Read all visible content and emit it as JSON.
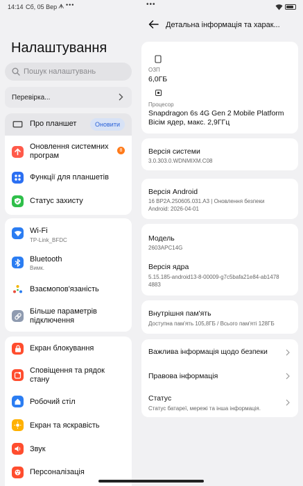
{
  "status": {
    "time": "14:14",
    "date": "Сб, 05 Вер",
    "nfc": "ᗗ",
    "more_left": "•••",
    "more_mid": "•••"
  },
  "left": {
    "title": "Налаштування",
    "search_placeholder": "Пошук налаштувань",
    "check_label": "Перевірка...",
    "about": {
      "label": "Про планшет",
      "button": "Оновити"
    },
    "group1": [
      {
        "label": "Оновлення системних програм",
        "badge": "8"
      },
      {
        "label": "Функції для планшетів"
      },
      {
        "label": "Статус захисту"
      }
    ],
    "group2": [
      {
        "label": "Wi-Fi",
        "sub": "TP-Link_BFDC"
      },
      {
        "label": "Bluetooth",
        "sub": "Вимк."
      },
      {
        "label": "Взаємопов'язаність"
      },
      {
        "label": "Більше параметрів підключення"
      }
    ],
    "group3": [
      {
        "label": "Екран блокування"
      },
      {
        "label": "Сповіщення та рядок стану"
      },
      {
        "label": "Робочий стіл"
      },
      {
        "label": "Екран та яскравість"
      },
      {
        "label": "Звук"
      },
      {
        "label": "Персоналізація"
      }
    ]
  },
  "right": {
    "title": "Детальна інформація та харак...",
    "ram_label": "ОЗП",
    "ram_value": "6,0ГБ",
    "cpu_label": "Процесор",
    "cpu_value_1": "Snapdragon 6s 4G Gen 2 Mobile Platform",
    "cpu_value_2": "Вісім ядер, макс. 2,9ГГц",
    "os_title": "Версія системи",
    "os_value": "3.0.303.0.WDNMIXM.C08",
    "android_title": "Версія Android",
    "android_value_1": "16 BP2A.250605.031.A3 | Оновлення безпеки",
    "android_value_2": "Android: 2026-04-01",
    "model_title": "Модель",
    "model_value": "2603APC14G",
    "kernel_title": "Версія ядра",
    "kernel_value_1": "5.15.185-android13-8-00009-g7c5bafa21e84-ab1478",
    "kernel_value_2": "4883",
    "storage_title": "Внутрішня пам'ять",
    "storage_value": "Доступна пам'ять  105,8ГБ / Всього пам'яті  128ГБ",
    "security_info": "Важлива інформація щодо безпеки",
    "legal_info": "Правова інформація",
    "status_title": "Статус",
    "status_sub": "Статус батареї, мережі та інша інформація."
  },
  "colors": {
    "accent": "#2a62d8",
    "badge": "#ff7a1a",
    "update_icon": "#ff5a4a",
    "features_icon": "#2b6ff2",
    "protect_icon": "#2fbf4a",
    "wifi_icon": "#2b7df2",
    "lock_icon": "#ff4d2e",
    "brightness_icon": "#ffb100"
  },
  "battery_level": 0.8
}
